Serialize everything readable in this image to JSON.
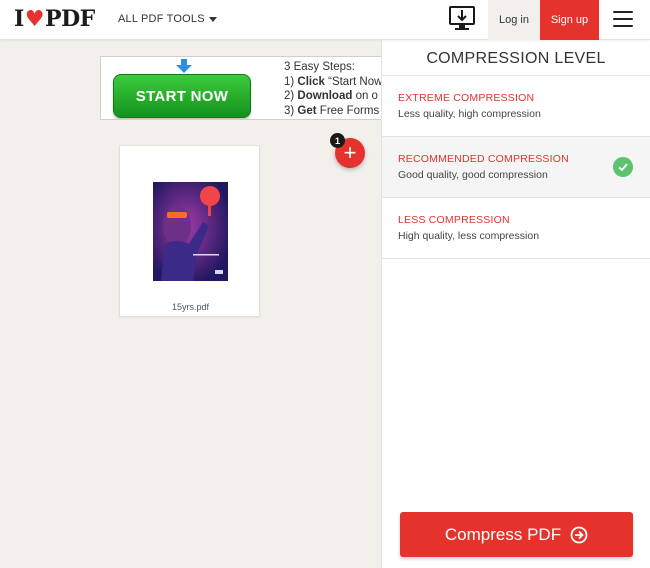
{
  "header": {
    "logo_left": "I",
    "logo_right": "PDF",
    "tools_menu": "ALL PDF TOOLS",
    "login": "Log in",
    "signup": "Sign up"
  },
  "ad": {
    "start_label": "START NOW",
    "steps_title": "3 Easy Steps:",
    "step1_num": "1) ",
    "step1_bold": "Click",
    "step1_rest": " “Start Now",
    "step2_num": "2) ",
    "step2_bold": "Download",
    "step2_rest": " on o",
    "step3_num": "3) ",
    "step3_bold": "Get",
    "step3_rest": " Free Forms O"
  },
  "upload": {
    "file_count": "1"
  },
  "file": {
    "name": "15yrs.pdf"
  },
  "panel": {
    "title": "COMPRESSION LEVEL",
    "options": [
      {
        "title": "EXTREME COMPRESSION",
        "desc": "Less quality, high compression",
        "selected": false
      },
      {
        "title": "RECOMMENDED COMPRESSION",
        "desc": "Good quality, good compression",
        "selected": true
      },
      {
        "title": "LESS COMPRESSION",
        "desc": "High quality, less compression",
        "selected": false
      }
    ],
    "action": "Compress PDF"
  },
  "colors": {
    "brand": "#e5322d",
    "check": "#5cc36e",
    "ad_button": "#22a82a",
    "background": "#f3f0ec"
  }
}
